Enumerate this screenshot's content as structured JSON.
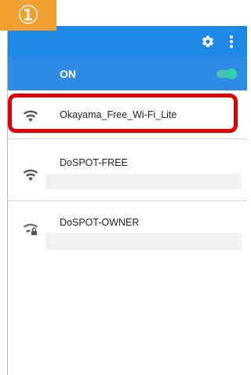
{
  "step_badge": "①",
  "header": {
    "settings_icon": "gear-icon",
    "menu_icon": "more-vert-icon"
  },
  "wifi_toggle": {
    "label": "ON",
    "state": "on",
    "color": "#2fd0a8"
  },
  "networks": [
    {
      "ssid": "Okayama_Free_Wi-Fi_Lite",
      "icon": "wifi-icon",
      "highlighted": true
    },
    {
      "ssid": "DoSPOT-FREE",
      "icon": "wifi-icon",
      "highlighted": false
    },
    {
      "ssid": "DoSPOT-OWNER",
      "icon": "wifi-lock-icon",
      "highlighted": false
    }
  ],
  "colors": {
    "accent": "#2e8be6",
    "highlight_border": "#e00000",
    "badge": "#f0a030"
  }
}
